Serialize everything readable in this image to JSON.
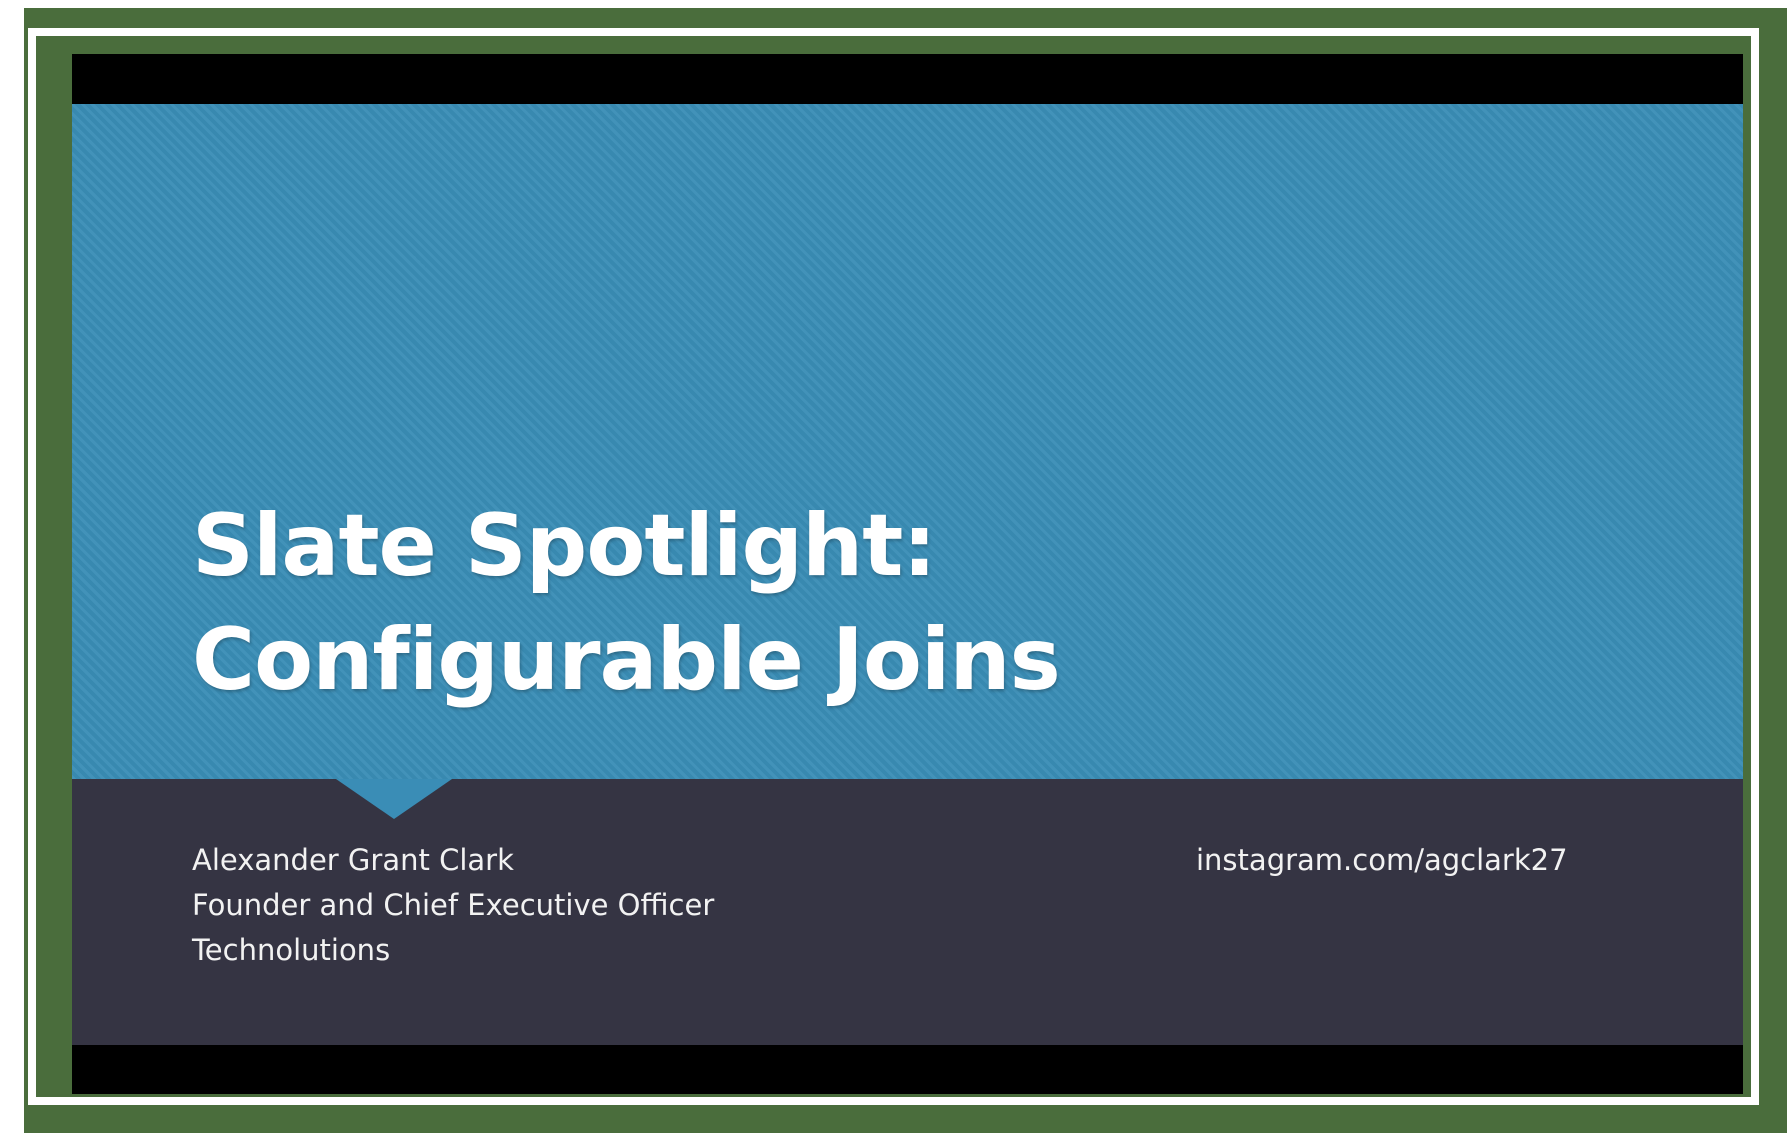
{
  "slide": {
    "title_line_1": "Slate Spotlight:",
    "title_line_2": "Configurable Joins",
    "presenter_name": "Alexander Grant Clark",
    "presenter_role": "Founder and Chief Executive Officer",
    "presenter_company": "Technolutions",
    "social_link": "instagram.com/agclark27"
  },
  "colors": {
    "frame_green": "#4a6d3c",
    "slide_blue": "#3a8db6",
    "band_dark": "#353443",
    "letterbox": "#000000"
  }
}
